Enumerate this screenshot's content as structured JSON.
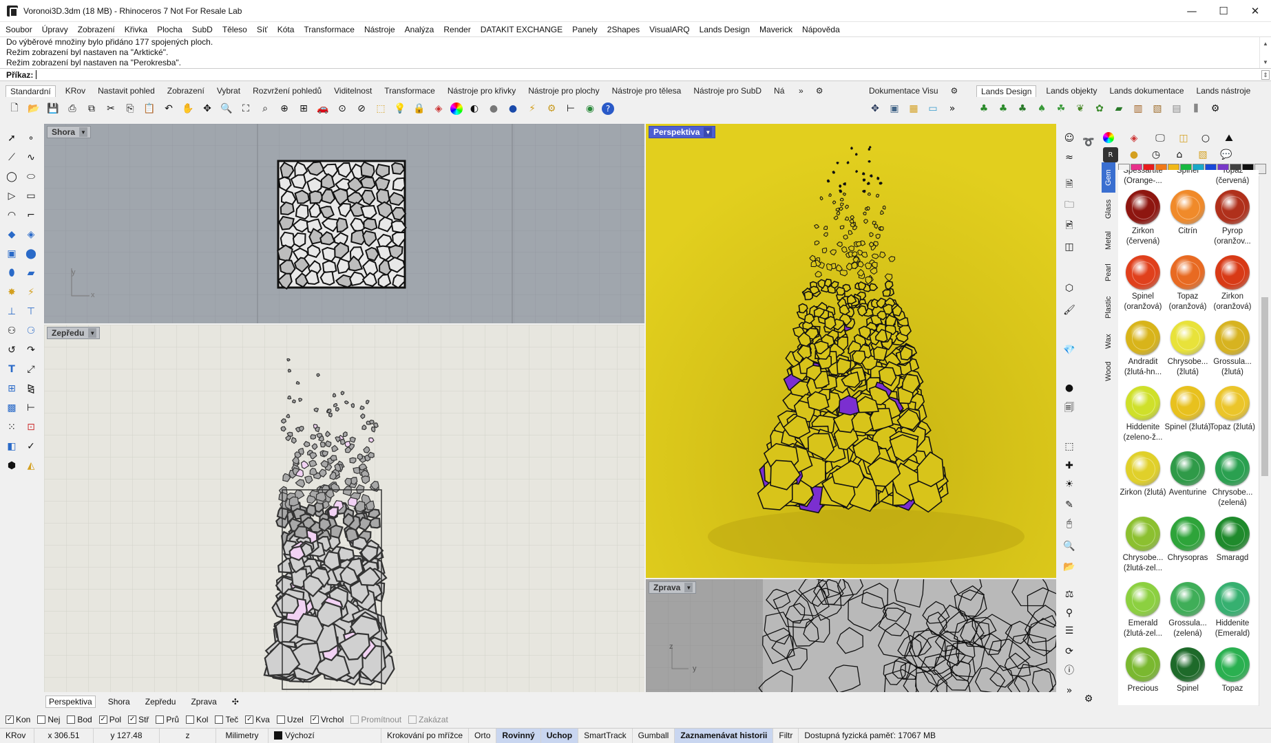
{
  "window": {
    "title": "Voronoi3D.3dm (18 MB) - Rhinoceros 7 Not For Resale Lab",
    "minimize": "—",
    "maximize": "☐",
    "close": "✕"
  },
  "menu": [
    "Soubor",
    "Úpravy",
    "Zobrazení",
    "Křivka",
    "Plocha",
    "SubD",
    "Těleso",
    "Síť",
    "Kóta",
    "Transformace",
    "Nástroje",
    "Analýza",
    "Render",
    "DATAKIT EXCHANGE",
    "Panely",
    "2Shapes",
    "VisualARQ",
    "Lands Design",
    "Maverick",
    "Nápověda"
  ],
  "history": [
    "Do výběrové množiny bylo přidáno 177 spojených ploch.",
    "Režim zobrazení byl nastaven na \"Arktické\".",
    "Režim zobrazení byl nastaven na \"Perokresba\"."
  ],
  "command": {
    "label": "Příkaz:"
  },
  "toolbar_tabs": [
    "Standardní",
    "KRov",
    "Nastavit pohled",
    "Zobrazení",
    "Vybrat",
    "Rozvržení pohledů",
    "Viditelnost",
    "Transformace",
    "Nástroje pro křivky",
    "Nástroje pro plochy",
    "Nástroje pro tělesa",
    "Nástroje pro SubD",
    "Ná"
  ],
  "toolbar_tabs_more": "»",
  "doc_tabs": [
    "Dokumentace Visu"
  ],
  "lands_tabs": [
    "Lands Design",
    "Lands objekty",
    "Lands dokumentace",
    "Lands nástroje"
  ],
  "viewports": {
    "top": {
      "label": "Shora",
      "axis_y": "y",
      "axis_x": "x"
    },
    "front": {
      "label": "Zepředu"
    },
    "perspective": {
      "label": "Perspektiva"
    },
    "right": {
      "label": "Zprava",
      "axis_z": "z",
      "axis_y": "y"
    }
  },
  "viewport_tabs": [
    "Perspektiva",
    "Shora",
    "Zepředu",
    "Zprava"
  ],
  "viewport_tab_add": "✣",
  "material_tabs": [
    "Gem",
    "Glass",
    "Metal",
    "Pearl",
    "Plastic",
    "Wax",
    "Wood"
  ],
  "materials": [
    {
      "name": "Spessartite (Orange-...",
      "color": "#e06a1e"
    },
    {
      "name": "Spinel",
      "color": "#c9302c"
    },
    {
      "name": "Topaz (červená)",
      "color": "#b3261e"
    },
    {
      "name": "Zirkon (červená)",
      "color": "#8e1610"
    },
    {
      "name": "Citrín",
      "color": "#f08a2a"
    },
    {
      "name": "Pyrop (oranžov...",
      "color": "#b0301b"
    },
    {
      "name": "Spinel (oranžová)",
      "color": "#e0401c"
    },
    {
      "name": "Topaz (oranžová)",
      "color": "#e86a22"
    },
    {
      "name": "Zirkon (oranžová)",
      "color": "#d83a16"
    },
    {
      "name": "Andradit (žlutá-hn...",
      "color": "#d8b41a"
    },
    {
      "name": "Chrysobe... (žlutá)",
      "color": "#e8e23a"
    },
    {
      "name": "Grossula... (žlutá)",
      "color": "#d7b320"
    },
    {
      "name": "Hiddenite (zeleno-ž...",
      "color": "#cfe02a"
    },
    {
      "name": "Spinel (žlutá)",
      "color": "#e8c11e"
    },
    {
      "name": "Topaz (žlutá)",
      "color": "#ebc52a"
    },
    {
      "name": "Zirkon (žlutá)",
      "color": "#e0d02a"
    },
    {
      "name": "Aventurine",
      "color": "#2f9a48"
    },
    {
      "name": "Chrysobe... (zelená)",
      "color": "#2aa050"
    },
    {
      "name": "Chrysobe... (žlutá-zel...",
      "color": "#8cc030"
    },
    {
      "name": "Chrysopras",
      "color": "#2ea43a"
    },
    {
      "name": "Smaragd",
      "color": "#1f8a2c"
    },
    {
      "name": "Emerald (žlutá-zel...",
      "color": "#8cd040"
    },
    {
      "name": "Grossula... (zelená)",
      "color": "#3fae58"
    },
    {
      "name": "Hiddenite (Emerald)",
      "color": "#36b070"
    },
    {
      "name": "Precious",
      "color": "#7ab830"
    },
    {
      "name": "Spinel",
      "color": "#1e6a2a"
    },
    {
      "name": "Topaz",
      "color": "#2ab050"
    }
  ],
  "swatch_colors": [
    "#f2f2f2",
    "#e8308a",
    "#e81c1c",
    "#f07818",
    "#f0b818",
    "#18b840",
    "#18a8c8",
    "#1848d8",
    "#7838c8",
    "#404040",
    "#101010",
    "#e8e8e8"
  ],
  "osnaps": [
    {
      "label": "Kon",
      "checked": "✓"
    },
    {
      "label": "Nej",
      "checked": ""
    },
    {
      "label": "Bod",
      "checked": ""
    },
    {
      "label": "Pol",
      "checked": "✓"
    },
    {
      "label": "Stř",
      "checked": "✓"
    },
    {
      "label": "Prů",
      "checked": ""
    },
    {
      "label": "Kol",
      "checked": ""
    },
    {
      "label": "Teč",
      "checked": ""
    },
    {
      "label": "Kva",
      "checked": "✓"
    },
    {
      "label": "Uzel",
      "checked": ""
    },
    {
      "label": "Vrchol",
      "checked": "✓"
    },
    {
      "label": "Promítnout",
      "checked": ""
    },
    {
      "label": "Zakázat",
      "checked": ""
    }
  ],
  "status": {
    "cplane": "KRov",
    "x": "x 306.51",
    "y": "y 127.48",
    "z": "z",
    "units": "Milimetry",
    "layer": "Výchozí",
    "grid_snap": "Krokování po mřížce",
    "ortho": "Orto",
    "planar": "Rovinný",
    "osnap": "Uchop",
    "smarttrack": "SmartTrack",
    "gumball": "Gumball",
    "history": "Zaznamenávat historii",
    "filter": "Filtr",
    "memory": "Dostupná fyzická paměť: 17067 MB"
  }
}
